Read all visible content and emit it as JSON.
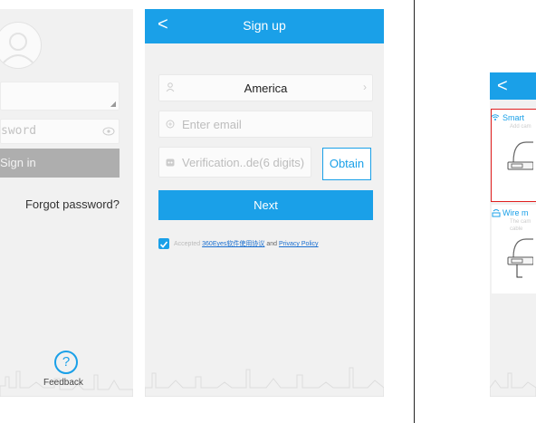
{
  "screen1": {
    "password_placeholder": "sword",
    "signin_label": "Sign in",
    "forgot_label": "Forgot password?",
    "feedback_label": "Feedback",
    "feedback_glyph": "?"
  },
  "screen2": {
    "title": "Sign up",
    "back_glyph": "<",
    "region_value": "America",
    "email_placeholder": "Enter email",
    "code_placeholder": "Verification..de(6 digits)",
    "obtain_label": "Obtain",
    "next_label": "Next",
    "agree_prefix": "Accepted",
    "agreement_link": "360Eyes软件使用协议",
    "agree_and": "and",
    "privacy_link": "Privacy Policy"
  },
  "screen3": {
    "back_glyph": "<",
    "smart_label": "Smart",
    "smart_desc": "Add cam",
    "wire_label": "Wire m",
    "wire_desc_1": "The cam",
    "wire_desc_2": "cable"
  },
  "colors": {
    "accent": "#1aa0e8",
    "highlight": "#e02020",
    "gray_button": "#aeaeae"
  }
}
